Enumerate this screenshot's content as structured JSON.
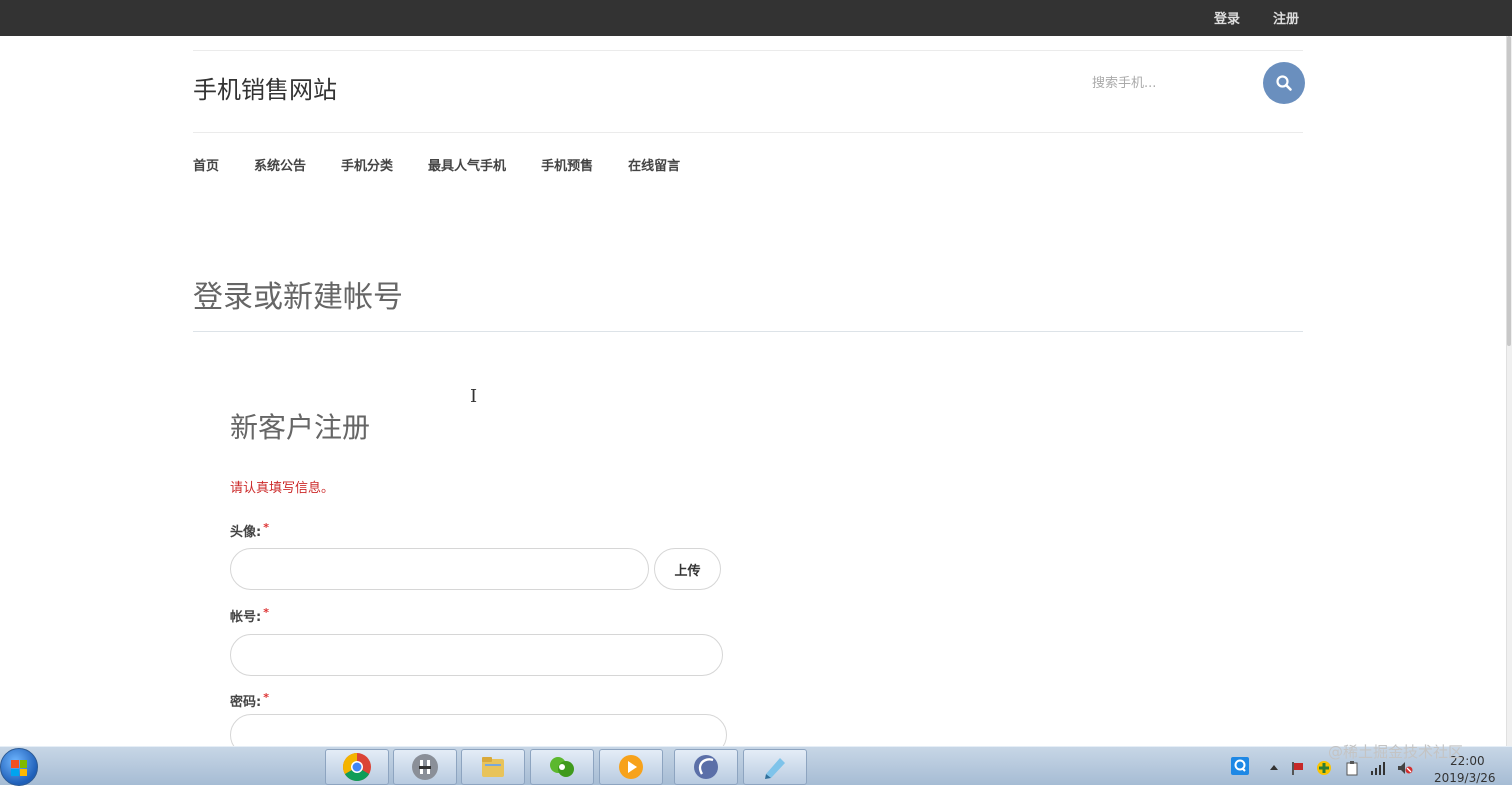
{
  "topbar": {
    "login": "登录",
    "register": "注册"
  },
  "header": {
    "site_title": "手机销售网站",
    "search_placeholder": "搜索手机..."
  },
  "nav": [
    "首页",
    "系统公告",
    "手机分类",
    "最具人气手机",
    "手机预售",
    "在线留言"
  ],
  "section": {
    "title": "登录或新建帐号"
  },
  "form": {
    "title": "新客户注册",
    "note": "请认真填写信息。",
    "required_mark": "*",
    "avatar_label": "头像:",
    "upload_label": "上传",
    "account_label": "帐号:",
    "password_label": "密码:"
  },
  "watermark": "@稀土掘金技术社区",
  "clock": {
    "time": "22:00",
    "date": "2019/3/26"
  },
  "colors": {
    "accent": "#6a8fbe",
    "note": "#cc2a2a",
    "topbar": "#333333"
  }
}
